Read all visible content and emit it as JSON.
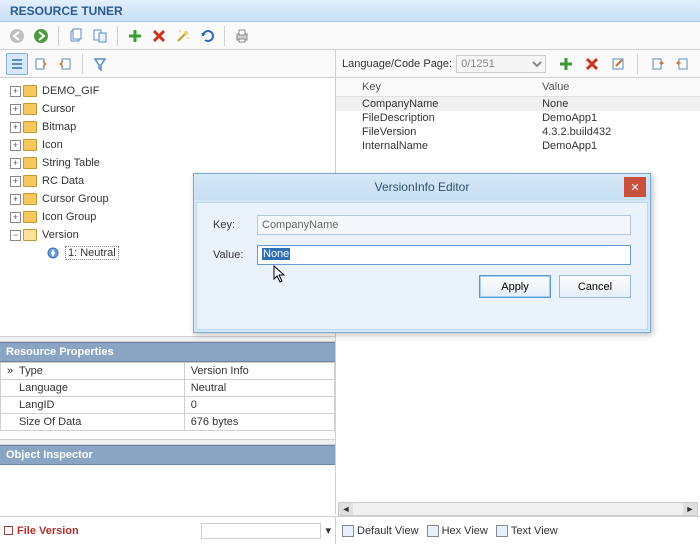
{
  "app_title": "RESOURCE TUNER",
  "lang_bar": {
    "label": "Language/Code Page:",
    "value": "0/1251"
  },
  "tree": {
    "items": [
      {
        "label": "DEMO_GIF"
      },
      {
        "label": "Cursor"
      },
      {
        "label": "Bitmap"
      },
      {
        "label": "Icon"
      },
      {
        "label": "String Table"
      },
      {
        "label": "RC Data"
      },
      {
        "label": "Cursor Group"
      },
      {
        "label": "Icon Group"
      }
    ],
    "version": {
      "label": "Version",
      "child": "1: Neutral"
    }
  },
  "kv": {
    "headers": {
      "key": "Key",
      "value": "Value"
    },
    "rows": [
      {
        "k": "CompanyName",
        "v": "None"
      },
      {
        "k": "FileDescription",
        "v": "DemoApp1"
      },
      {
        "k": "FileVersion",
        "v": "4.3.2.build432"
      },
      {
        "k": "InternalName",
        "v": "DemoApp1"
      }
    ]
  },
  "props": {
    "header": "Resource Properties",
    "rows": [
      {
        "k": "Type",
        "v": "Version Info",
        "chev": true
      },
      {
        "k": "Language",
        "v": "Neutral"
      },
      {
        "k": "LangID",
        "v": "0"
      },
      {
        "k": "Size Of Data",
        "v": "676 bytes"
      }
    ],
    "inspector": "Object Inspector"
  },
  "bottom": {
    "file_version": "File Version",
    "views": {
      "default": "Default View",
      "hex": "Hex View",
      "text": "Text View"
    }
  },
  "dialog": {
    "title": "VersionInfo Editor",
    "key_label": "Key:",
    "key_value": "CompanyName",
    "value_label": "Value:",
    "value_value": "None",
    "apply": "Apply",
    "cancel": "Cancel"
  }
}
